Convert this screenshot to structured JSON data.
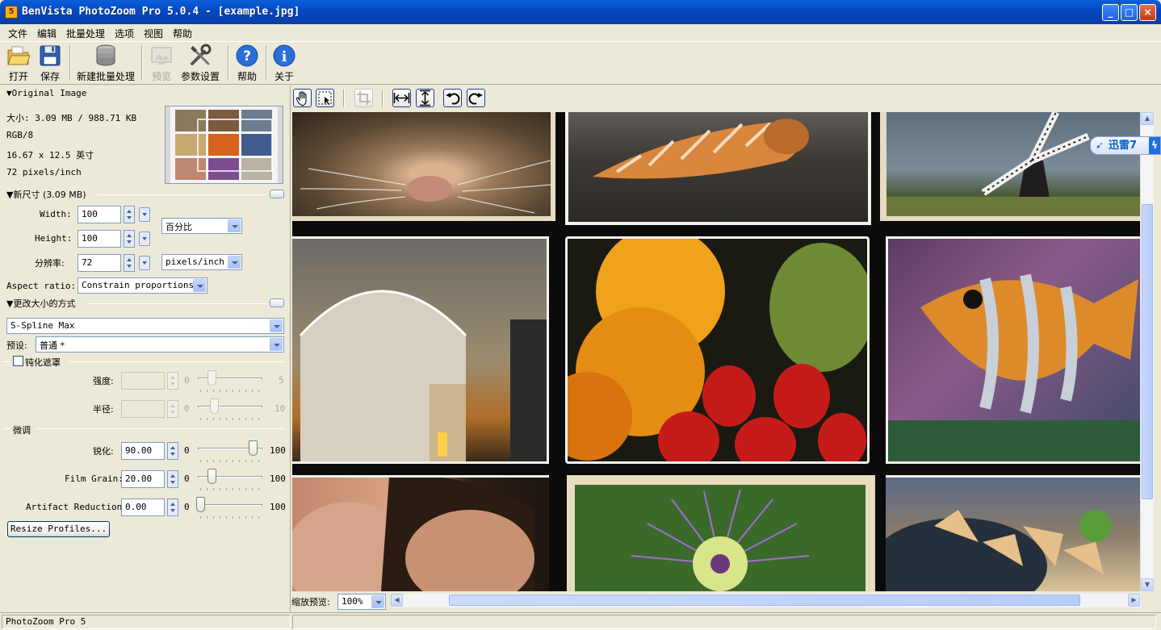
{
  "window": {
    "title": "BenVista PhotoZoom Pro 5.0.4 - [example.jpg]",
    "minimize_label": "_",
    "maximize_label": "□",
    "close_label": "×"
  },
  "menu": [
    "文件",
    "编辑",
    "批量处理",
    "选项",
    "视图",
    "帮助"
  ],
  "toolbar": {
    "open": "打开",
    "save": "保存",
    "new_batch": "新建批量处理",
    "preview": "预览",
    "settings": "参数设置",
    "help": "帮助",
    "about": "关于"
  },
  "original_image": {
    "header": "Original Image",
    "size": "大小: 3.09 MB / 988.71 KB",
    "mode": "RGB/8",
    "dimensions": "16.67 x 12.5 英寸",
    "resolution": "72 pixels/inch"
  },
  "new_size": {
    "header": "新尺寸 (3.09 MB)",
    "width_label": "Width:",
    "width_value": "100",
    "height_label": "Height:",
    "height_value": "100",
    "resolution_label": "分辨率:",
    "resolution_value": "72",
    "unit_value": "百分比",
    "res_unit_value": "pixels/inch",
    "aspect_label": "Aspect ratio:",
    "aspect_value": "Constrain proportions"
  },
  "resize_method": {
    "header": "更改大小的方式",
    "method_value": "S-Spline Max",
    "preset_label": "预设:",
    "preset_value": "普通 *"
  },
  "unsharp": {
    "checkbox_label": "钝化遮罩",
    "strength_label": "强度:",
    "strength_min": "0",
    "strength_max": "5",
    "radius_label": "半径:",
    "radius_min": "0",
    "radius_max": "10"
  },
  "finetune": {
    "header": "微调",
    "sharpen_label": "锐化:",
    "sharpen_value": "90.00",
    "sharpen_level": 0.9,
    "film_grain_label": "Film Grain:",
    "film_grain_value": "20.00",
    "film_grain_level": 0.2,
    "artifact_label": "Artifact Reduction:",
    "artifact_value": "0.00",
    "artifact_level": 0,
    "min": "0",
    "max": "100",
    "profiles_button": "Resize Profiles..."
  },
  "view": {
    "zoom_label": "缩放预览:",
    "zoom_value": "100%"
  },
  "status": {
    "app": "PhotoZoom Pro 5"
  },
  "badge": {
    "text": "迅雷7"
  },
  "colors": {
    "title_bar": "#0a4fc8",
    "accent": "#316ac5",
    "face": "#ece9d8"
  }
}
